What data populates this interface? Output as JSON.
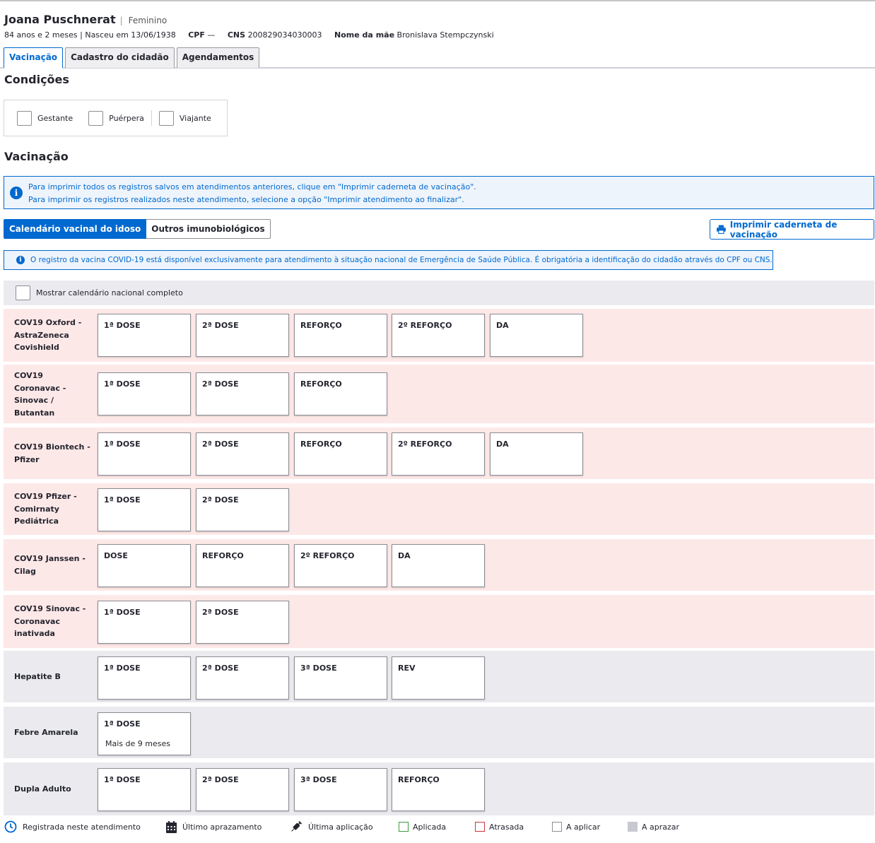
{
  "patient": {
    "name": "Joana Puschnerat",
    "gender": "Feminino",
    "age_birth": "84 anos e 2 meses | Nasceu em 13/06/1938",
    "cpf_label": "CPF",
    "cpf_value": "—",
    "cns_label": "CNS",
    "cns_value": "200829034030003",
    "mother_label": "Nome da mãe",
    "mother_value": "Bronislava Stempczynski"
  },
  "tabs": [
    "Vacinação",
    "Cadastro do cidadão",
    "Agendamentos"
  ],
  "conditions": {
    "title": "Condições",
    "items": [
      "Gestante",
      "Puérpera",
      "Viajante"
    ]
  },
  "vaccination": {
    "title": "Vacinação",
    "info_line1": "Para imprimir todos os registros salvos em atendimentos anteriores, clique em \"Imprimir caderneta de vacinação\".",
    "info_line2": "Para imprimir os registros realizados neste atendimento, selecione a opção \"Imprimir atendimento ao finalizar\".",
    "segment": [
      "Calendário vacinal do idoso",
      "Outros imunobiológicos"
    ],
    "print_button": "Imprimir caderneta de vacinação",
    "covid_notice": "O registro da vacina COVID-19 está disponível exclusivamente para atendimento à situação nacional de Emergência de Saúde Pública. É obrigatória a identificação do cidadão através do CPF ou CNS.",
    "show_all_label": "Mostrar calendário nacional completo"
  },
  "vaccines": [
    {
      "name": "COV19 Oxford - AstraZeneca Covishield",
      "type": "covid",
      "doses": [
        {
          "label": "1ª DOSE"
        },
        {
          "label": "2ª DOSE"
        },
        {
          "label": "REFORÇO"
        },
        {
          "label": "2º REFORÇO"
        },
        {
          "label": "DA"
        }
      ]
    },
    {
      "name": "COV19 Coronavac - Sinovac / Butantan",
      "type": "covid",
      "doses": [
        {
          "label": "1ª DOSE"
        },
        {
          "label": "2ª DOSE"
        },
        {
          "label": "REFORÇO"
        }
      ]
    },
    {
      "name": "COV19 Biontech - Pfizer",
      "type": "covid",
      "doses": [
        {
          "label": "1ª DOSE"
        },
        {
          "label": "2ª DOSE"
        },
        {
          "label": "REFORÇO"
        },
        {
          "label": "2º REFORÇO"
        },
        {
          "label": "DA"
        }
      ]
    },
    {
      "name": "COV19 Pfizer - Comirnaty Pediátrica",
      "type": "covid",
      "doses": [
        {
          "label": "1ª DOSE"
        },
        {
          "label": "2ª DOSE"
        }
      ]
    },
    {
      "name": "COV19 Janssen - Cilag",
      "type": "covid",
      "doses": [
        {
          "label": "DOSE"
        },
        {
          "label": "REFORÇO"
        },
        {
          "label": "2º REFORÇO"
        },
        {
          "label": "DA"
        }
      ]
    },
    {
      "name": "COV19 Sinovac - Coronavac inativada",
      "type": "covid",
      "doses": [
        {
          "label": "1ª DOSE"
        },
        {
          "label": "2ª DOSE"
        }
      ]
    },
    {
      "name": "Hepatite B",
      "type": "normal",
      "doses": [
        {
          "label": "1ª DOSE"
        },
        {
          "label": "2ª DOSE"
        },
        {
          "label": "3ª DOSE"
        },
        {
          "label": "REV"
        }
      ]
    },
    {
      "name": "Febre Amarela",
      "type": "normal",
      "doses": [
        {
          "label": "1ª DOSE",
          "sub": "Mais de 9 meses"
        }
      ]
    },
    {
      "name": "Dupla Adulto",
      "type": "normal",
      "doses": [
        {
          "label": "1ª DOSE"
        },
        {
          "label": "2ª DOSE"
        },
        {
          "label": "3ª DOSE"
        },
        {
          "label": "REFORÇO"
        }
      ]
    }
  ],
  "legend": {
    "registered": "Registrada neste atendimento",
    "last_scheduling": "Último aprazamento",
    "last_application": "Última aplicação",
    "applied": "Aplicada",
    "late": "Atrasada",
    "to_apply": "A aplicar",
    "to_schedule": "A aprazar"
  },
  "colors": {
    "primary": "#0069d0",
    "covid_row": "#fde8e8",
    "normal_row": "#ebebef",
    "applied": "#3d9a3d",
    "late": "#d0343c",
    "to_schedule": "#c8c8d0"
  }
}
